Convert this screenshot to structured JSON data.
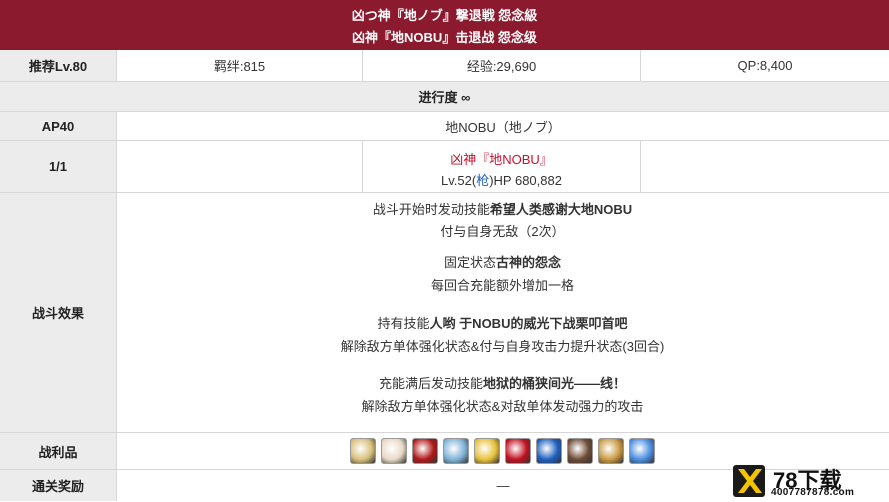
{
  "title": {
    "line1": "凶つ神『地ノブ』撃退戦 怨念級",
    "line2": "凶神『地NOBU』击退战 怨念级"
  },
  "rewards_row": {
    "label": "推荐Lv.80",
    "bond": "羁绊:815",
    "exp": "经验:29,690",
    "qp": "QP:8,400"
  },
  "progress": {
    "label": "进行度 ∞"
  },
  "ap_row": {
    "label": "AP40",
    "enemy_name": "地NOBU（地ノブ）"
  },
  "wave_row": {
    "label": "1/1",
    "enemy_title": "凶神『地NOBU』",
    "lv_prefix": "Lv.52(",
    "class": "枪",
    "hp_suffix": ")HP 680,882"
  },
  "effects": {
    "label": "战斗效果",
    "lines": [
      {
        "plain": "战斗开始时发动技能",
        "bold": "希望人类感谢大地NOBU"
      },
      {
        "plain": "付与自身无敌（2次）",
        "bold": ""
      },
      {
        "plain": "固定状态",
        "bold": "古神的怨念"
      },
      {
        "plain": "每回合充能额外增加一格",
        "bold": ""
      },
      {
        "plain": "持有技能",
        "bold": "人哟 于NOBU的威光下战栗叩首吧"
      },
      {
        "plain": "解除敌方单体强化状态&付与自身攻击力提升状态(3回合)",
        "bold": ""
      },
      {
        "plain": "充能满后发动技能",
        "bold": "地狱的桶狭间光——线！"
      },
      {
        "plain": "解除敌方单体强化状态&对敌单体发动强力的攻击",
        "bold": ""
      }
    ]
  },
  "drops": {
    "label": "战利品",
    "items": [
      {
        "icon": "portrait-card-icon",
        "color": "#d8c07a"
      },
      {
        "icon": "portrait-card-icon",
        "color": "#e8d9c6"
      },
      {
        "icon": "red-gem-icon",
        "color": "#b01818"
      },
      {
        "icon": "blue-lantern-icon",
        "color": "#7fb3d8"
      },
      {
        "icon": "gold-gear-icon",
        "color": "#e6c13a"
      },
      {
        "icon": "ruby-icon",
        "color": "#c01020"
      },
      {
        "icon": "blue-orb-icon",
        "color": "#1d5fc0"
      },
      {
        "icon": "horn-icon",
        "color": "#6d4a34"
      },
      {
        "icon": "seed-icon",
        "color": "#c99a40"
      },
      {
        "icon": "crystal-icon",
        "color": "#4a8de0"
      }
    ]
  },
  "clear_reward": {
    "label": "通关奖励",
    "value": "—"
  },
  "watermark": {
    "brand": "78下载",
    "url": "4007787878.com"
  }
}
